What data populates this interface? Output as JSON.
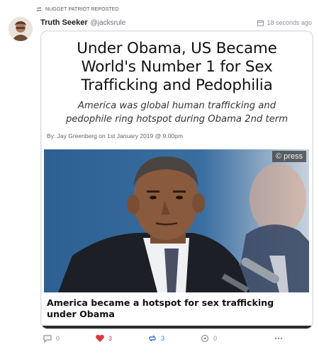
{
  "repost": {
    "label": "NUGGET PATRIOT REPOSTED"
  },
  "post": {
    "display_name": "Truth Seeker",
    "handle": "@jacksrule",
    "timestamp": "18 seconds ago"
  },
  "card": {
    "headline_lines": [
      "Under Obama, US Became",
      "World's Number 1 for Sex",
      "Trafficking and Pedophilia"
    ],
    "subhead_lines": [
      "America was global human trafficking and",
      "pedophile ring hotspot during Obama 2nd term"
    ],
    "byline": "By: Jay Greenberg on 1st January 2019 @ 9.00pm",
    "image_badge": "© press",
    "caption_lines": [
      "America became a hotspot for sex trafficking",
      "under Obama"
    ]
  },
  "actions": {
    "replies": "0",
    "likes": "3",
    "boosts": "3",
    "quotes": "0"
  },
  "colors": {
    "like": "#d9383e",
    "boost": "#3b7ddd",
    "muted": "#8a8f99"
  }
}
